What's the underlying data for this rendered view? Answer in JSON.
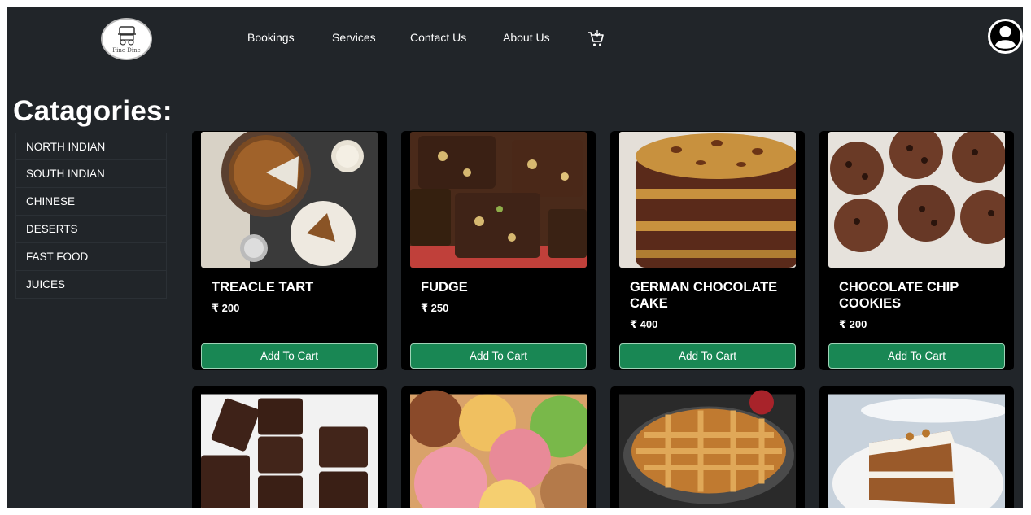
{
  "navbar": {
    "logo_text": "Fine Dine",
    "links": [
      "Bookings",
      "Services",
      "Contact Us",
      "About Us"
    ],
    "cart_icon": "shopping-cart-icon",
    "user_icon": "user-circle-icon"
  },
  "categories": {
    "title": "Catagories:",
    "items": [
      "NORTH INDIAN",
      "SOUTH INDIAN",
      "CHINESE",
      "DESERTS",
      "FAST FOOD",
      "JUICES"
    ]
  },
  "products": [
    {
      "name": "TREACLE TART",
      "price": "₹ 200",
      "button": "Add To Cart"
    },
    {
      "name": "FUDGE",
      "price": "₹ 250",
      "button": "Add To Cart"
    },
    {
      "name": "GERMAN CHOCOLATE CAKE",
      "price": "₹ 400",
      "button": "Add To Cart"
    },
    {
      "name": "CHOCOLATE CHIP COOKIES",
      "price": "₹ 200",
      "button": "Add To Cart"
    }
  ],
  "colors": {
    "background": "#212529",
    "card": "#000000",
    "button": "#198754",
    "text": "#ffffff"
  }
}
